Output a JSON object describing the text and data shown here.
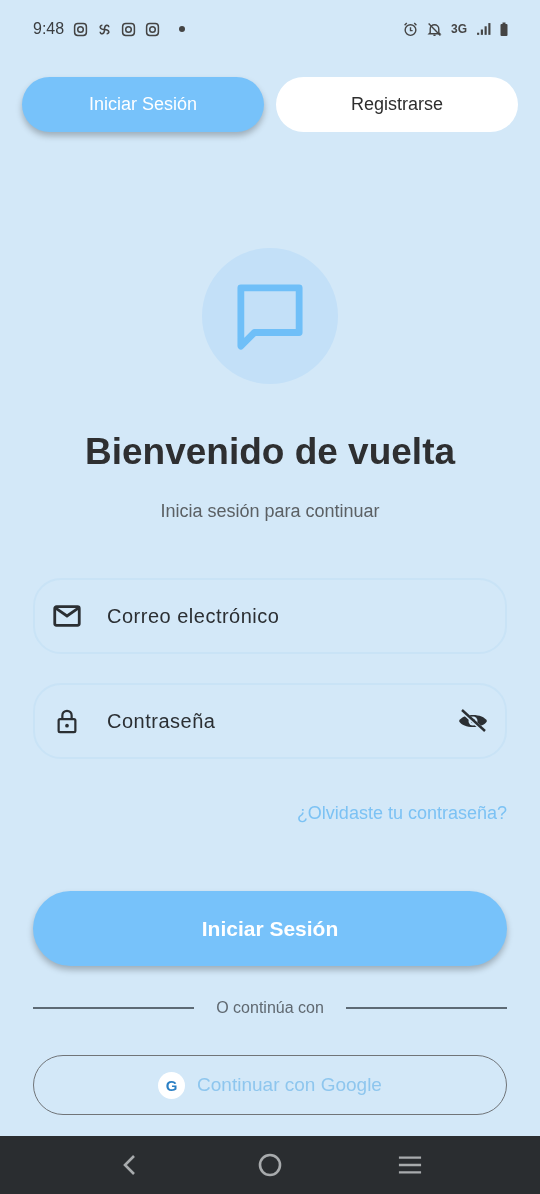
{
  "status_bar": {
    "time": "9:48",
    "network": "3G"
  },
  "tabs": [
    {
      "label": "Iniciar Sesión",
      "selected": true
    },
    {
      "label": "Registrarse",
      "selected": false
    }
  ],
  "title": "Bienvenido de vuelta",
  "subtitle": "Inicia sesión para continuar",
  "fields": [
    {
      "kind": "email",
      "placeholder": "Correo electrónico"
    },
    {
      "kind": "password",
      "placeholder": "Contraseña"
    }
  ],
  "forgot_link": "¿Olvidaste tu contraseña?",
  "submit_button": "Iniciar Sesión",
  "divider_text": "O continúa con",
  "google_button": {
    "badge": "G",
    "label": "Continuar con Google"
  }
}
